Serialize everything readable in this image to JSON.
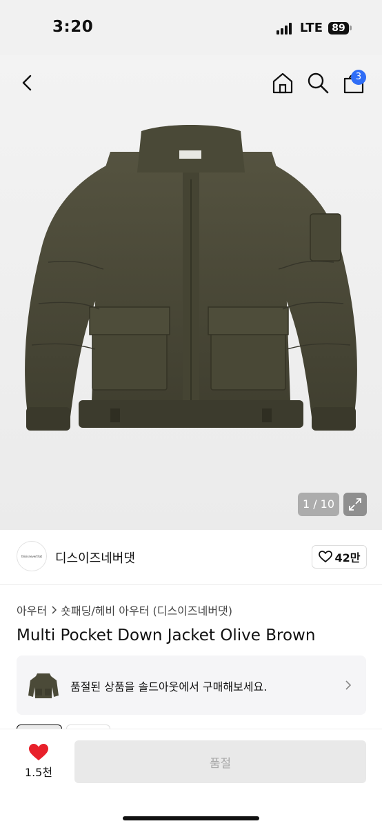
{
  "status": {
    "time": "3:20",
    "network": "LTE",
    "battery": "89"
  },
  "nav": {
    "cart_count": "3"
  },
  "gallery": {
    "pager": "1 / 10"
  },
  "brand": {
    "logo_text": "thisisneverthat",
    "name": "디스이즈네버댓",
    "likes": "42만"
  },
  "breadcrumb": {
    "items": [
      "아우터",
      "숏패딩/헤비 아우터 (디스이즈네버댓)"
    ]
  },
  "product": {
    "title": "Multi Pocket Down Jacket Olive Brown"
  },
  "soldout_banner": {
    "text": "품절된 상품을 솔드아웃에서 구매해보세요."
  },
  "bottom_bar": {
    "wish_count": "1.5천",
    "buy_label": "품절"
  },
  "colors": {
    "accent_blue": "#2f6df6",
    "heart_red": "#e8202a",
    "jacket_olive": "#4b4a38"
  }
}
